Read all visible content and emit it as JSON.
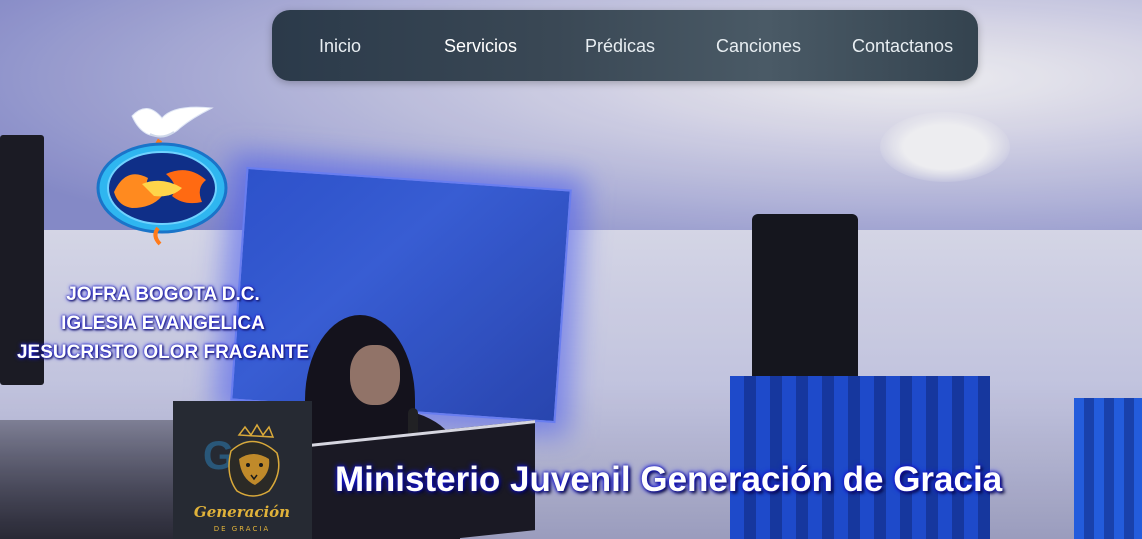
{
  "nav": {
    "items": [
      {
        "label": "Inicio"
      },
      {
        "label": "Servicios"
      },
      {
        "label": "Prédicas"
      },
      {
        "label": "Canciones"
      },
      {
        "label": "Contactanos"
      }
    ],
    "active": "Servicios"
  },
  "brand": {
    "line1": "JOFRA BOGOTA D.C.",
    "line2": "IGLESIA EVANGELICA",
    "line3": "JESUCRISTO OLOR FRAGANTE"
  },
  "ministry": {
    "title": "Ministerio Juvenil Generación de Gracia",
    "logo_text": "Generación",
    "logo_subtext": "DE GRACIA",
    "logo_monogram": "GG"
  },
  "colors": {
    "navbar": "#3a4855",
    "text_glow": "#2b2bff",
    "logo_gold": "#d9a93a"
  },
  "icons": {
    "church_logo": "dove-globe-flame-logo",
    "ministry_logo": "lion-crown-logo"
  }
}
